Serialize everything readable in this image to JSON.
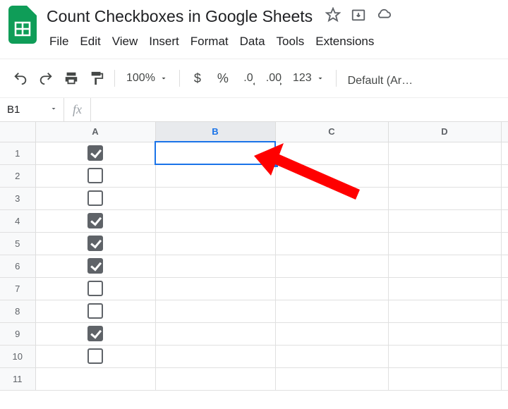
{
  "doc": {
    "title": "Count Checkboxes in Google Sheets"
  },
  "menu": [
    "File",
    "Edit",
    "View",
    "Insert",
    "Format",
    "Data",
    "Tools",
    "Extensions"
  ],
  "zoom": "100%",
  "formats": {
    "currency": "$",
    "percent": "%",
    "dec_dec": ".0",
    "dec_inc": ".00",
    "more": "123"
  },
  "font": "Default (Ari…",
  "nameBox": "B1",
  "fx": "fx",
  "columns": [
    "A",
    "B",
    "C",
    "D"
  ],
  "selectedColIndex": 1,
  "selectedRow": 1,
  "rows": [
    {
      "n": 1,
      "a_checked": true
    },
    {
      "n": 2,
      "a_checked": false
    },
    {
      "n": 3,
      "a_checked": false
    },
    {
      "n": 4,
      "a_checked": true
    },
    {
      "n": 5,
      "a_checked": true
    },
    {
      "n": 6,
      "a_checked": true
    },
    {
      "n": 7,
      "a_checked": false
    },
    {
      "n": 8,
      "a_checked": false
    },
    {
      "n": 9,
      "a_checked": true
    },
    {
      "n": 10,
      "a_checked": false
    },
    {
      "n": 11,
      "a_checked": null
    }
  ]
}
